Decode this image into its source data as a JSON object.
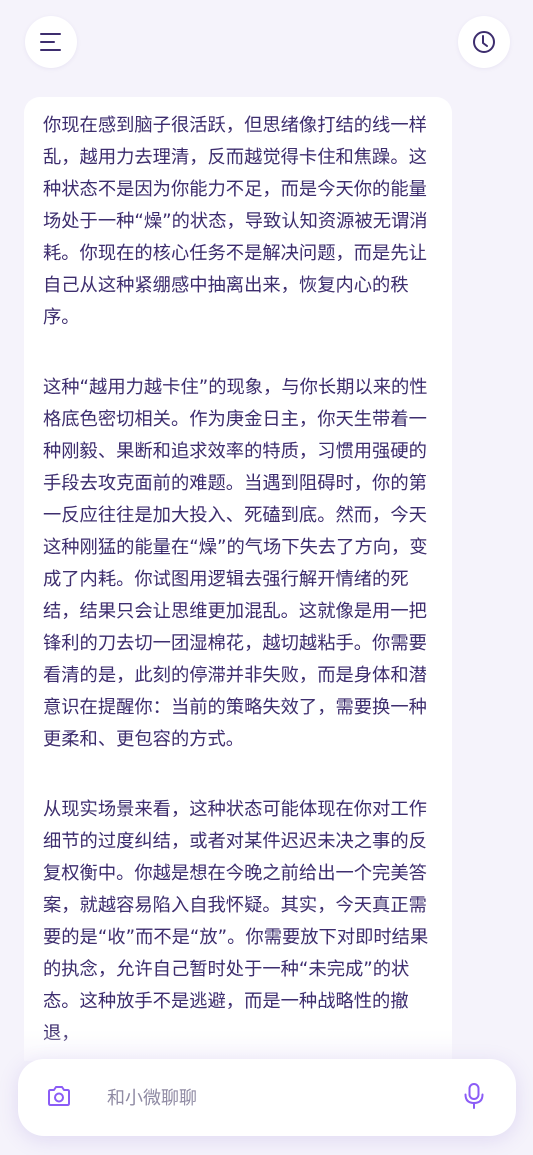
{
  "header": {
    "menu_icon": "menu-icon",
    "history_icon": "clock-icon"
  },
  "message": {
    "paragraphs": [
      "你现在感到脑子很活跃，但思绪像打结的线一样乱，越用力去理清，反而越觉得卡住和焦躁。这种状态不是因为你能力不足，而是今天你的能量场处于一种“燥”的状态，导致认知资源被无谓消耗。你现在的核心任务不是解决问题，而是先让自己从这种紧绷感中抽离出来，恢复内心的秩序。",
      "这种“越用力越卡住”的现象，与你长期以来的性格底色密切相关。作为庚金日主，你天生带着一种刚毅、果断和追求效率的特质，习惯用强硬的手段去攻克面前的难题。当遇到阻碍时，你的第一反应往往是加大投入、死磕到底。然而，今天这种刚猛的能量在“燥”的气场下失去了方向，变成了内耗。你试图用逻辑去强行解开情绪的死结，结果只会让思维更加混乱。这就像是用一把锋利的刀去切一团湿棉花，越切越粘手。你需要看清的是，此刻的停滞并非失败，而是身体和潜意识在提醒你：当前的策略失效了，需要换一种更柔和、更包容的方式。",
      "从现实场景来看，这种状态可能体现在你对工作细节的过度纠结，或者对某件迟迟未决之事的反复权衡中。你越是想在今晚之前给出一个完美答案，就越容易陷入自我怀疑。其实，今天真正需要的是“收”而不是“放”。你需要放下对即时结果的执念，允许自己暂时处于一种“未完成”的状态。这种放手不是逃避，而是一种战略性的撤退，"
    ]
  },
  "composer": {
    "placeholder": "和小微聊聊",
    "camera_icon": "camera-icon",
    "mic_icon": "microphone-icon"
  },
  "colors": {
    "accent": "#8b5cf6",
    "text": "#3d2d6e",
    "background": "#f5f3fb"
  }
}
